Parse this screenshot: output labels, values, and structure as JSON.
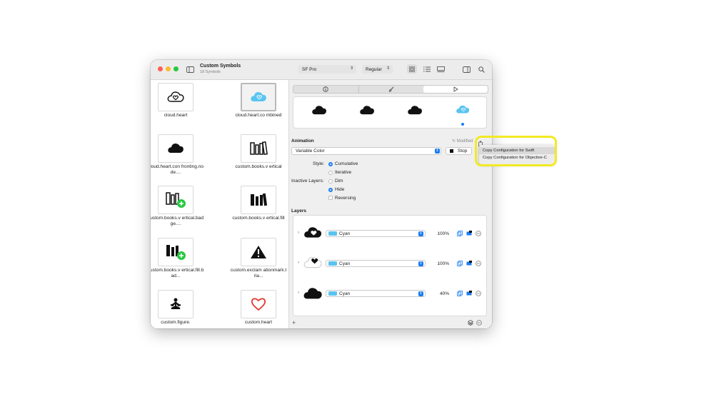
{
  "window": {
    "title": "Custom Symbols",
    "subtitle": "18 Symbols",
    "font_popup": "SF Pro",
    "weight_popup": "Regular"
  },
  "icons": {
    "sidebar_toggle": "sidebar-toggle-icon",
    "grid_view": "grid-view-icon",
    "list_view": "list-view-icon",
    "gallery_view": "gallery-view-icon",
    "inspector_toggle": "inspector-toggle-icon",
    "search": "search-icon"
  },
  "symbols": [
    {
      "label": "cloud.heart"
    },
    {
      "label": "cloud.heart.co mbined"
    },
    {
      "label": "cloud.heart.con fronting.node...."
    },
    {
      "label": "custom.books.v ertical"
    },
    {
      "label": "custom.books.v ertical.badge...."
    },
    {
      "label": "custom.books.v ertical.fill"
    },
    {
      "label": "custom.books.v ertical.fill.bad..."
    },
    {
      "label": "custom.exclam ationmark.tria..."
    },
    {
      "label": "custom.figure."
    },
    {
      "label": "custom.heart"
    }
  ],
  "inspector": {
    "tabs": [
      "info",
      "rendering",
      "animation"
    ],
    "animation_header": "Animation",
    "modified_label": "Modified",
    "effect_value": "Variable Color",
    "stop_label": "Stop",
    "style_label": "Style:",
    "style_options": [
      "Cumulative",
      "Iterative"
    ],
    "style_selected": "Cumulative",
    "inactive_label": "Inactive Layers:",
    "inactive_options": [
      "Dim",
      "Hide"
    ],
    "inactive_selected": "Hide",
    "reversing_label": "Reversing",
    "reversing_checked": false,
    "layers_header": "Layers",
    "layers": [
      {
        "color_name": "Cyan",
        "opacity": "100%"
      },
      {
        "color_name": "Cyan",
        "opacity": "100%"
      },
      {
        "color_name": "Cyan",
        "opacity": "40%"
      }
    ]
  },
  "context_menu": {
    "items": [
      "Copy Configuration for Swift",
      "Copy Configuration for Objective-C"
    ]
  },
  "colors": {
    "accent": "#1a7cf3",
    "cyan": "#5ac4f0",
    "highlight": "#f2ea24"
  }
}
